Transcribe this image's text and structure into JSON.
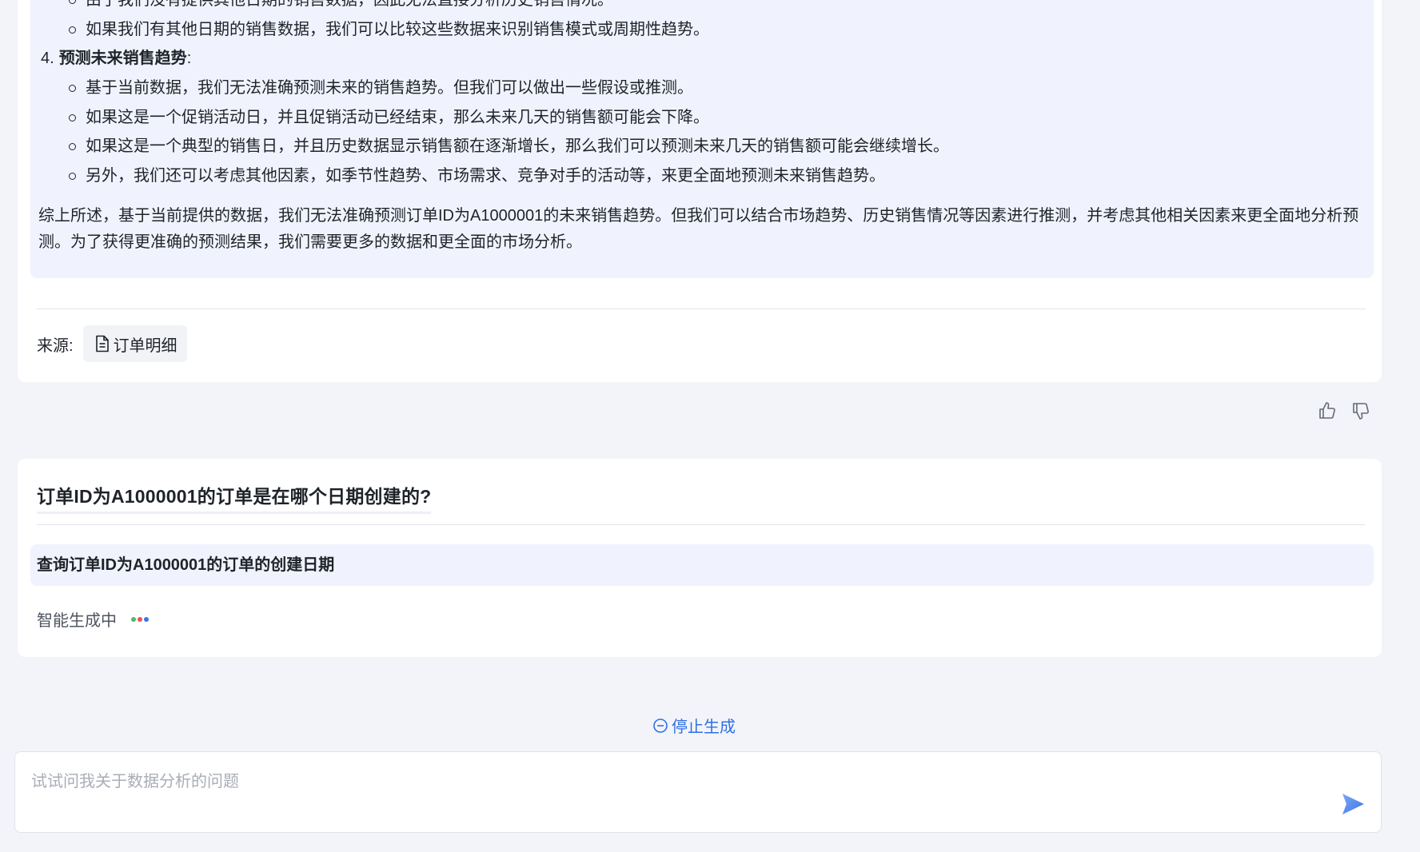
{
  "answer": {
    "bullets_top": [
      "由于我们没有提供其他日期的销售数据，因此无法直接分析历史销售情况。",
      "如果我们有其他日期的销售数据，我们可以比较这些数据来识别销售模式或周期性趋势。"
    ],
    "section4": {
      "number": "4.",
      "title": "预测未来销售趋势",
      "colon": ":"
    },
    "bullets_section4": [
      "基于当前数据，我们无法准确预测未来的销售趋势。但我们可以做出一些假设或推测。",
      "如果这是一个促销活动日，并且促销活动已经结束，那么未来几天的销售额可能会下降。",
      "如果这是一个典型的销售日，并且历史数据显示销售额在逐渐增长，那么我们可以预测未来几天的销售额可能会继续增长。",
      "另外，我们还可以考虑其他因素，如季节性趋势、市场需求、竞争对手的活动等，来更全面地预测未来销售趋势。"
    ],
    "summary": "综上所述，基于当前提供的数据，我们无法准确预测订单ID为A1000001的未来销售趋势。但我们可以结合市场趋势、历史销售情况等因素进行推测，并考虑其他相关因素来更全面地分析预测。为了获得更准确的预测结果，我们需要更多的数据和更全面的市场分析。",
    "source_label": "来源:",
    "source_name": "订单明细",
    "source_icon": "document-icon"
  },
  "feedback": {
    "like_icon": "thumbs-up-icon",
    "dislike_icon": "thumbs-down-icon"
  },
  "question": {
    "title": "订单ID为A1000001的订单是在哪个日期创建的?",
    "query": "查询订单ID为A1000001的订单的创建日期",
    "status": "智能生成中",
    "dot_colors": [
      "#4fb873",
      "#e8564a",
      "#3b73e8"
    ]
  },
  "stop": {
    "label": "停止生成",
    "icon": "stop-circle-icon"
  },
  "input": {
    "placeholder": "试试问我关于数据分析的问题",
    "value": "",
    "send_icon": "send-icon"
  },
  "colors": {
    "accent": "#2f6fe4",
    "panel": "#f0f3fd",
    "background": "#f3f4f9"
  }
}
